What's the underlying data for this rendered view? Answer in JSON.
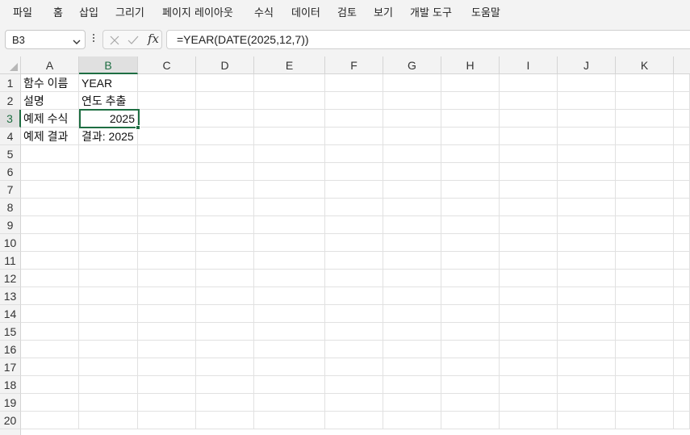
{
  "menu": [
    "파일",
    "홈",
    "삽입",
    "그리기",
    "페이지 레이아웃",
    "수식",
    "데이터",
    "검토",
    "보기",
    "개발 도구",
    "도움말"
  ],
  "name_box": "B3",
  "formula_bar": {
    "fx_label": "fx",
    "formula": "=YEAR(DATE(2025,12,7))"
  },
  "columns": [
    "A",
    "B",
    "C",
    "D",
    "E",
    "F",
    "G",
    "H",
    "I",
    "J",
    "K"
  ],
  "selected_column": "B",
  "selected_row": 3,
  "rows": [
    1,
    2,
    3,
    4,
    5,
    6,
    7,
    8,
    9,
    10,
    11,
    12,
    13,
    14,
    15,
    16,
    17,
    18,
    19,
    20
  ],
  "cells": {
    "A1": "함수 이름",
    "B1": "YEAR",
    "A2": "설명",
    "B2": "연도 추출",
    "A3": "예제 수식",
    "B3": "2025",
    "A4": "예제 결과",
    "B4": "결과: 2025"
  },
  "icons": {
    "name_box_dropdown": "chevron-down-icon",
    "more": "vertical-dots-icon",
    "cancel": "x-icon",
    "enter": "check-icon",
    "insert_function": "fx-icon"
  },
  "colors": {
    "accent": "#1e6e42",
    "header_bg": "#f3f3f3",
    "gridline": "#e1e1e1"
  }
}
